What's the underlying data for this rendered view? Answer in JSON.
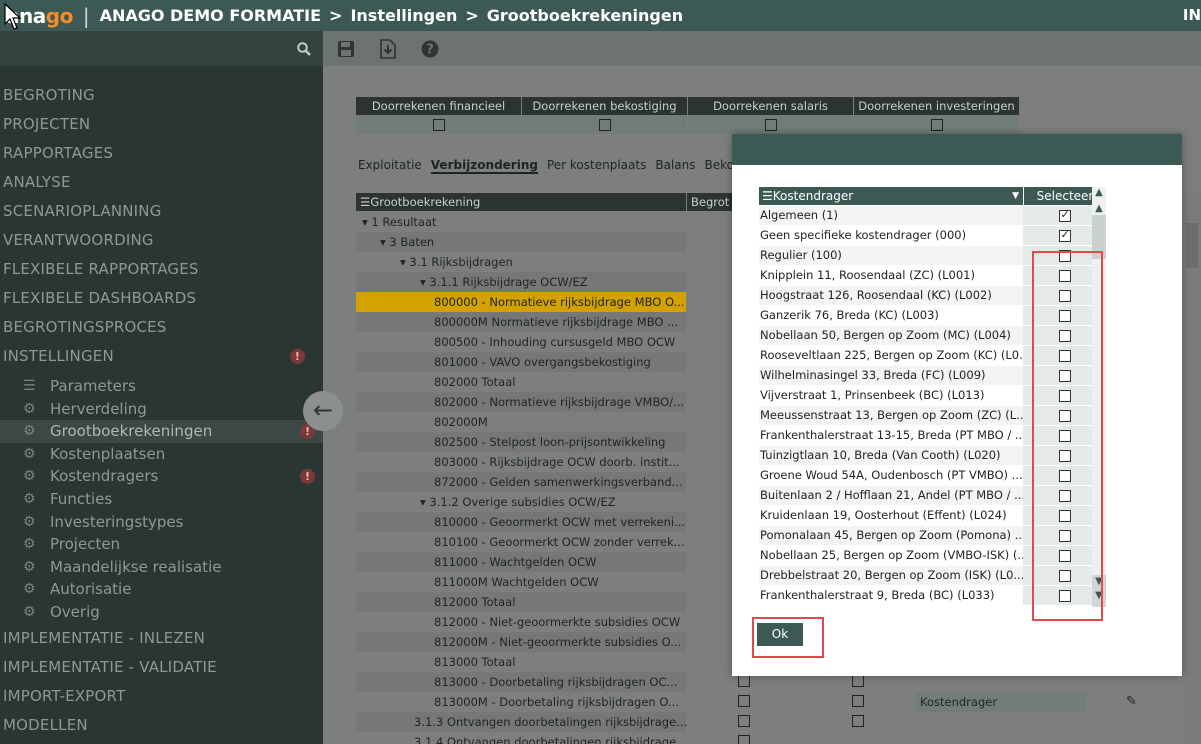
{
  "topbar": {
    "logo_a": "a",
    "logo_n": "na",
    "logo_g": "g",
    "logo_o": "o",
    "crumbs": [
      "ANAGO DEMO FORMATIE",
      "Instellingen",
      "Grootboekrekeningen"
    ],
    "crumb_sep": ">",
    "user": "IN"
  },
  "sidebar": {
    "menu": [
      "BEGROTING",
      "PROJECTEN",
      "RAPPORTAGES",
      "ANALYSE",
      "SCENARIOPLANNING",
      "VERANTWOORDING",
      "FLEXIBELE RAPPORTAGES",
      "FLEXIBELE DASHBOARDS",
      "BEGROTINGSPROCES",
      "INSTELLINGEN"
    ],
    "alert_glyph": "!",
    "sub": [
      "Parameters",
      "Herverdeling",
      "Grootboekrekeningen",
      "Kostenplaatsen",
      "Kostendragers",
      "Functies",
      "Investeringstypes",
      "Projecten",
      "Maandelijkse realisatie",
      "Autorisatie",
      "Overig"
    ],
    "menu_bottom": [
      "IMPLEMENTATIE - INLEZEN",
      "IMPLEMENTATIE - VALIDATIE",
      "IMPORT-EXPORT",
      "MODELLEN"
    ]
  },
  "main": {
    "calc_headers": [
      "Doorrekenen financieel",
      "Doorrekenen bekostiging",
      "Doorrekenen salaris",
      "Doorrekenen investeringen"
    ],
    "tabs": [
      "Exploitatie",
      "Verbijzondering",
      "Per kostenplaats",
      "Balans",
      "Bekostigi"
    ],
    "grid_header": "Grootboekrekening",
    "grid_header2": "Begrot",
    "rows": [
      "▾ 1 Resultaat",
      "▾ 3 Baten",
      "▾ 3.1 Rijksbijdragen",
      "▾ 3.1.1 Rijksbijdrage OCW/EZ",
      "800000 - Normatieve rijksbijdrage MBO O...",
      "800000M Normatieve rijksbijdrage MBO ...",
      "800500 - Inhouding cursusgeld MBO OCW",
      "801000 - VAVO overgangsbekostiging",
      "802000 Totaal",
      "802000 - Normatieve rijksbijdrage VMBO/...",
      "802000M",
      "802500 - Stelpost loon-prijsontwikkeling",
      "803000 - Rijksbijdrage OCW doorb. instit...",
      "872000 - Gelden samenwerkingsverband...",
      "▾ 3.1.2 Overige subsidies OCW/EZ",
      "810000 - Geoormerkt OCW met verrekeni...",
      "810100 - Geoormerkt OCW zonder verrek...",
      "811000 - Wachtgelden OCW",
      "811000M Wachtgelden OCW",
      "812000 Totaal",
      "812000 - Niet-geoormerkte subsidies OCW",
      "812000M - Niet-geoormerkte subsidies O...",
      "813000 Totaal",
      "813000 - Doorbetaling rijksbijdragen OC...",
      "813000M - Doorbetaling rijksbijdragen O...",
      "3.1.3 Ontvangen doorbetalingen rijksbijdrage...",
      "3.1.4 Ontvangen doorbetalingen rijksbijdrage..."
    ],
    "row_dropdown_label": "Kostendrager"
  },
  "dialog": {
    "col_name": "Kostendrager",
    "col_select": "Selecteer",
    "items": [
      {
        "name": "Algemeen (1)",
        "checked": true
      },
      {
        "name": "Geen specifieke kostendrager (000)",
        "checked": true
      },
      {
        "name": "Regulier (100)",
        "checked": false
      },
      {
        "name": "Knipplein 11, Roosendaal (ZC) (L001)",
        "checked": false
      },
      {
        "name": "Hoogstraat 126, Roosendaal (KC) (L002)",
        "checked": false
      },
      {
        "name": "Ganzerik 76, Breda (KC) (L003)",
        "checked": false
      },
      {
        "name": "Nobellaan 50, Bergen op Zoom (MC) (L004)",
        "checked": false
      },
      {
        "name": "Rooseveltlaan 225, Bergen op Zoom (KC) (L0...",
        "checked": false
      },
      {
        "name": "Wilhelminasingel 33, Breda (FC) (L009)",
        "checked": false
      },
      {
        "name": "Vijverstraat 1, Prinsenbeek (BC) (L013)",
        "checked": false
      },
      {
        "name": "Meeussenstraat 13, Bergen op Zoom (ZC) (L...",
        "checked": false
      },
      {
        "name": "Frankenthalerstraat 13-15, Breda (PT MBO / ...",
        "checked": false
      },
      {
        "name": "Tuinzigtlaan 10, Breda (Van Cooth) (L020)",
        "checked": false
      },
      {
        "name": "Groene Woud 54A, Oudenbosch (PT VMBO) ...",
        "checked": false
      },
      {
        "name": "Buitenlaan 2 / Hofflaan 21, Andel (PT MBO / ...",
        "checked": false
      },
      {
        "name": "Kruidenlaan 19, Oosterhout (Effent) (L024)",
        "checked": false
      },
      {
        "name": "Pomonalaan 45, Bergen op Zoom (Pomona) ...",
        "checked": false
      },
      {
        "name": "Nobellaan 25, Bergen op Zoom (VMBO-ISK) (...",
        "checked": false
      },
      {
        "name": "Drebbelstraat 20, Bergen op Zoom (ISK) (L0...",
        "checked": false
      },
      {
        "name": "Frankenthalerstraat 9, Breda (BC) (L033)",
        "checked": false
      }
    ],
    "ok_label": "Ok"
  }
}
